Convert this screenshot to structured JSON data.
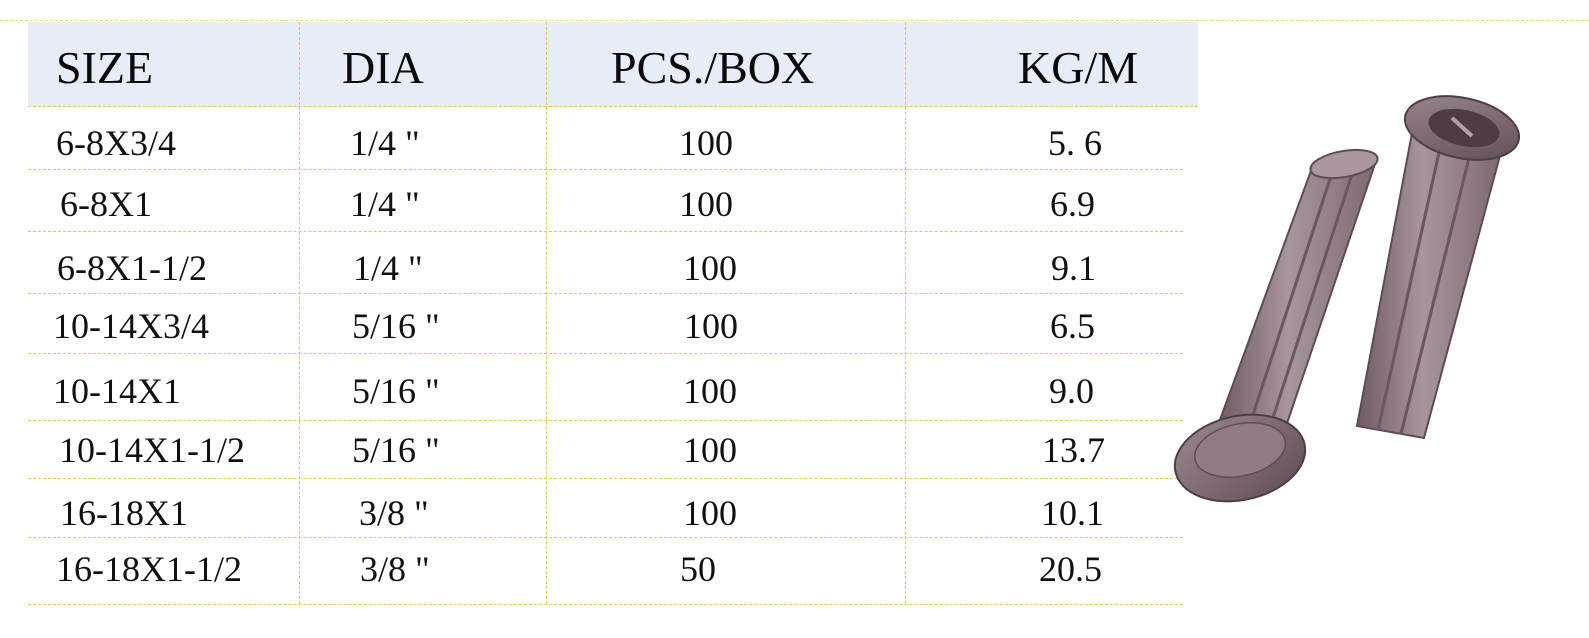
{
  "table": {
    "headers": [
      "SIZE",
      "DIA",
      "PCS./BOX",
      "KG/M"
    ],
    "rows": [
      [
        "6-8X3/4",
        "1/4 \"",
        "100",
        "5. 6"
      ],
      [
        "6-8X1",
        "1/4 \"",
        "100",
        "6.9"
      ],
      [
        "6-8X1-1/2",
        "1/4 \"",
        "100",
        "9.1"
      ],
      [
        "10-14X3/4",
        "5/16 \"",
        "100",
        "6.5"
      ],
      [
        "10-14X1",
        "5/16 \"",
        "100",
        "9.0"
      ],
      [
        "10-14X1-1/2",
        "5/16 \"",
        "100",
        "13.7"
      ],
      [
        "16-18X1",
        "3/8 \"",
        "100",
        "10.1"
      ],
      [
        "16-18X1-1/2",
        "3/8 \"",
        "50",
        "20.5"
      ]
    ]
  },
  "colors": {
    "header_bg": "#e7edf7",
    "rule": "#e9c25a",
    "plug_body": "#8e7a83"
  },
  "image": {
    "icon": "plastic-wall-anchor-icon"
  }
}
